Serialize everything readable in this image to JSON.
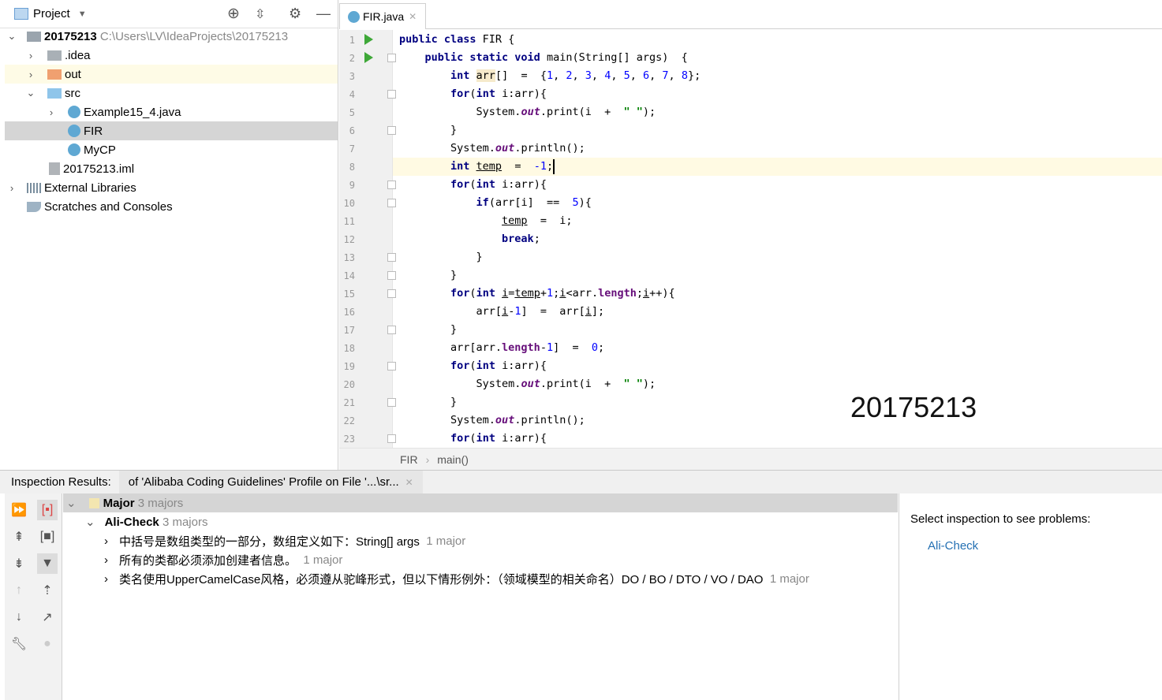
{
  "project_panel": {
    "title": "Project",
    "root": {
      "name": "20175213",
      "path": "C:\\Users\\LV\\IdeaProjects\\20175213"
    },
    "items": [
      {
        "label": ".idea"
      },
      {
        "label": "out"
      },
      {
        "label": "src"
      },
      {
        "label": "Example15_4.java"
      },
      {
        "label": "FIR"
      },
      {
        "label": "MyCP"
      },
      {
        "label": "20175213.iml"
      },
      {
        "label": "External Libraries"
      },
      {
        "label": "Scratches and Consoles"
      }
    ]
  },
  "editor": {
    "tab": "FIR.java",
    "lines": [
      [
        [
          "k",
          "public class "
        ],
        [
          "p",
          "FIR {"
        ]
      ],
      [
        [
          "p",
          "    "
        ],
        [
          "k",
          "public static void "
        ],
        [
          "p",
          "main(String[] args)  {"
        ]
      ],
      [
        [
          "p",
          "        "
        ],
        [
          "k",
          "int "
        ],
        [
          "h",
          "arr"
        ],
        [
          "p",
          "[]  =  {"
        ],
        [
          "n",
          "1"
        ],
        [
          "p",
          ", "
        ],
        [
          "n",
          "2"
        ],
        [
          "p",
          ", "
        ],
        [
          "n",
          "3"
        ],
        [
          "p",
          ", "
        ],
        [
          "n",
          "4"
        ],
        [
          "p",
          ", "
        ],
        [
          "n",
          "5"
        ],
        [
          "p",
          ", "
        ],
        [
          "n",
          "6"
        ],
        [
          "p",
          ", "
        ],
        [
          "n",
          "7"
        ],
        [
          "p",
          ", "
        ],
        [
          "n",
          "8"
        ],
        [
          "p",
          "};"
        ]
      ],
      [
        [
          "p",
          "        "
        ],
        [
          "k",
          "for"
        ],
        [
          "p",
          "("
        ],
        [
          "k",
          "int "
        ],
        [
          "p",
          "i:arr){"
        ]
      ],
      [
        [
          "p",
          "            System."
        ],
        [
          "f",
          "out"
        ],
        [
          "p",
          ".print(i  +  "
        ],
        [
          "s",
          "\" \""
        ],
        [
          "p",
          ");"
        ]
      ],
      [
        [
          "p",
          "        }"
        ]
      ],
      [
        [
          "p",
          "        System."
        ],
        [
          "f",
          "out"
        ],
        [
          "p",
          ".println();"
        ]
      ],
      [
        [
          "p",
          "        "
        ],
        [
          "k",
          "int "
        ],
        [
          "u",
          "temp"
        ],
        [
          "p",
          "  =  "
        ],
        [
          "n",
          "-1"
        ],
        [
          "p",
          ";"
        ]
      ],
      [
        [
          "p",
          "        "
        ],
        [
          "k",
          "for"
        ],
        [
          "p",
          "("
        ],
        [
          "k",
          "int "
        ],
        [
          "p",
          "i:arr){"
        ]
      ],
      [
        [
          "p",
          "            "
        ],
        [
          "k",
          "if"
        ],
        [
          "p",
          "(arr[i]  ==  "
        ],
        [
          "n",
          "5"
        ],
        [
          "p",
          "){"
        ]
      ],
      [
        [
          "p",
          "                "
        ],
        [
          "u",
          "temp"
        ],
        [
          "p",
          "  =  i;"
        ]
      ],
      [
        [
          "p",
          "                "
        ],
        [
          "k",
          "break"
        ],
        [
          "p",
          ";"
        ]
      ],
      [
        [
          "p",
          "            }"
        ]
      ],
      [
        [
          "p",
          "        }"
        ]
      ],
      [
        [
          "p",
          "        "
        ],
        [
          "k",
          "for"
        ],
        [
          "p",
          "("
        ],
        [
          "k",
          "int "
        ],
        [
          "u",
          "i"
        ],
        [
          "p",
          "="
        ],
        [
          "u",
          "temp"
        ],
        [
          "p",
          "+"
        ],
        [
          "n",
          "1"
        ],
        [
          "p",
          ";"
        ],
        [
          "u",
          "i"
        ],
        [
          "p",
          "<arr."
        ],
        [
          "fl",
          "length"
        ],
        [
          "p",
          ";"
        ],
        [
          "u",
          "i"
        ],
        [
          "p",
          "++){"
        ]
      ],
      [
        [
          "p",
          "            arr["
        ],
        [
          "u",
          "i"
        ],
        [
          "p",
          "-"
        ],
        [
          "n",
          "1"
        ],
        [
          "p",
          "]  =  arr["
        ],
        [
          "u",
          "i"
        ],
        [
          "p",
          "];"
        ]
      ],
      [
        [
          "p",
          "        }"
        ]
      ],
      [
        [
          "p",
          "        arr[arr."
        ],
        [
          "fl",
          "length"
        ],
        [
          "p",
          "-"
        ],
        [
          "n",
          "1"
        ],
        [
          "p",
          "]  =  "
        ],
        [
          "n",
          "0"
        ],
        [
          "p",
          ";"
        ]
      ],
      [
        [
          "p",
          "        "
        ],
        [
          "k",
          "for"
        ],
        [
          "p",
          "("
        ],
        [
          "k",
          "int "
        ],
        [
          "p",
          "i:arr){"
        ]
      ],
      [
        [
          "p",
          "            System."
        ],
        [
          "f",
          "out"
        ],
        [
          "p",
          ".print(i  +  "
        ],
        [
          "s",
          "\" \""
        ],
        [
          "p",
          ");"
        ]
      ],
      [
        [
          "p",
          "        }"
        ]
      ],
      [
        [
          "p",
          "        System."
        ],
        [
          "f",
          "out"
        ],
        [
          "p",
          ".println();"
        ]
      ],
      [
        [
          "p",
          "        "
        ],
        [
          "k",
          "for"
        ],
        [
          "p",
          "("
        ],
        [
          "k",
          "int "
        ],
        [
          "p",
          "i:arr){"
        ]
      ]
    ],
    "watermark": "20175213",
    "current_line": 8
  },
  "breadcrumb": [
    "FIR",
    "main()"
  ],
  "inspection": {
    "label": "Inspection Results:",
    "tab": "of 'Alibaba Coding Guidelines' Profile on File '...\\sr...",
    "group": {
      "name": "Major",
      "count": "3 majors"
    },
    "check": {
      "name": "Ali-Check",
      "count": "3 majors"
    },
    "problems": [
      {
        "text": "中括号是数组类型的一部分，数组定义如下：String[] args",
        "count": "1 major"
      },
      {
        "text": "所有的类都必须添加创建者信息。",
        "count": "1 major"
      },
      {
        "text": "类名使用UpperCamelCase风格，必须遵从驼峰形式，但以下情形例外：（领域模型的相关命名）DO / BO / DTO / VO / DAO",
        "count": "1 major"
      }
    ],
    "detail_prompt": "Select inspection to see problems:",
    "detail_link": "Ali-Check"
  },
  "colors": {
    "keyword": "#000080",
    "number": "#0000ff",
    "field": "#660e7a",
    "string": "#008000",
    "link": "#2470b3",
    "current_line": "#fffae3"
  }
}
